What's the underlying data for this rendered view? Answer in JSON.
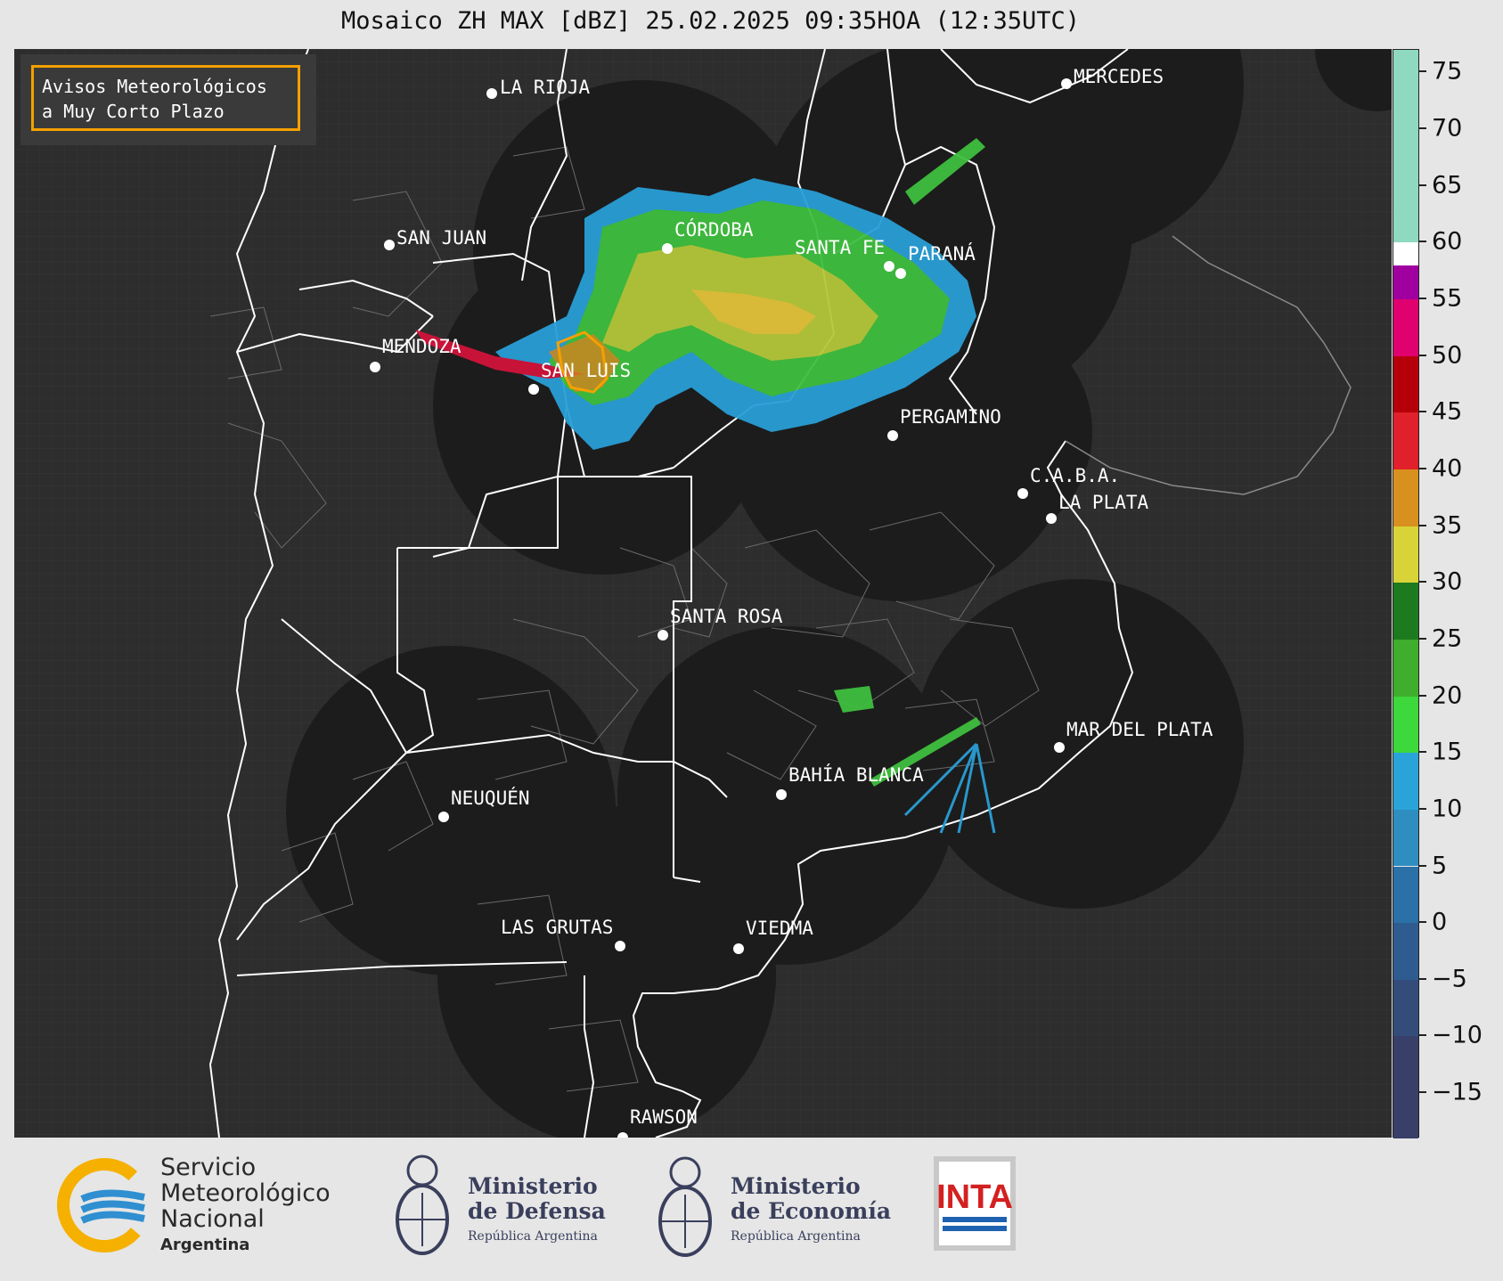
{
  "title": "Mosaico ZH MAX [dBZ] 25.02.2025 09:35HOA (12:35UTC)",
  "warning_box": {
    "line1": "Avisos Meteorológicos",
    "line2": "a Muy Corto Plazo",
    "border_color": "#f5a000"
  },
  "cities": [
    {
      "name": "LA RIOJA"
    },
    {
      "name": "MERCEDES"
    },
    {
      "name": "SAN JUAN"
    },
    {
      "name": "CÓRDOBA"
    },
    {
      "name": "SANTA FE"
    },
    {
      "name": "PARANÁ"
    },
    {
      "name": "MENDOZA"
    },
    {
      "name": "SAN LUIS"
    },
    {
      "name": "PERGAMINO"
    },
    {
      "name": "C.A.B.A."
    },
    {
      "name": "LA PLATA"
    },
    {
      "name": "SANTA ROSA"
    },
    {
      "name": "MAR DEL PLATA"
    },
    {
      "name": "BAHÍA BLANCA"
    },
    {
      "name": "NEUQUÉN"
    },
    {
      "name": "LAS GRUTAS"
    },
    {
      "name": "VIEDMA"
    },
    {
      "name": "RAWSON"
    }
  ],
  "colorbar": {
    "unit": "dBZ",
    "min": -19,
    "max": 77,
    "ticks": [
      "75",
      "70",
      "65",
      "60",
      "55",
      "50",
      "45",
      "40",
      "35",
      "30",
      "25",
      "20",
      "15",
      "10",
      "5",
      "0",
      "−5",
      "−10",
      "−15"
    ],
    "tick_values": [
      75,
      70,
      65,
      60,
      55,
      50,
      45,
      40,
      35,
      30,
      25,
      20,
      15,
      10,
      5,
      0,
      -5,
      -10,
      -15
    ]
  },
  "colors": {
    "map_background": "#2d2d2d",
    "radar_coverage": "#1c1c1c",
    "province_border": "#ffffff",
    "department_border": "#6a6a6a"
  },
  "footer": {
    "smn": {
      "line1": "Servicio",
      "line2": "Meteorológico",
      "line3": "Nacional",
      "line4": "Argentina"
    },
    "defensa": {
      "line1": "Ministerio",
      "line2": "de Defensa",
      "line3": "República Argentina"
    },
    "economia": {
      "line1": "Ministerio",
      "line2": "de Economía",
      "line3": "República Argentina"
    },
    "inta": {
      "text": "INTA"
    }
  }
}
